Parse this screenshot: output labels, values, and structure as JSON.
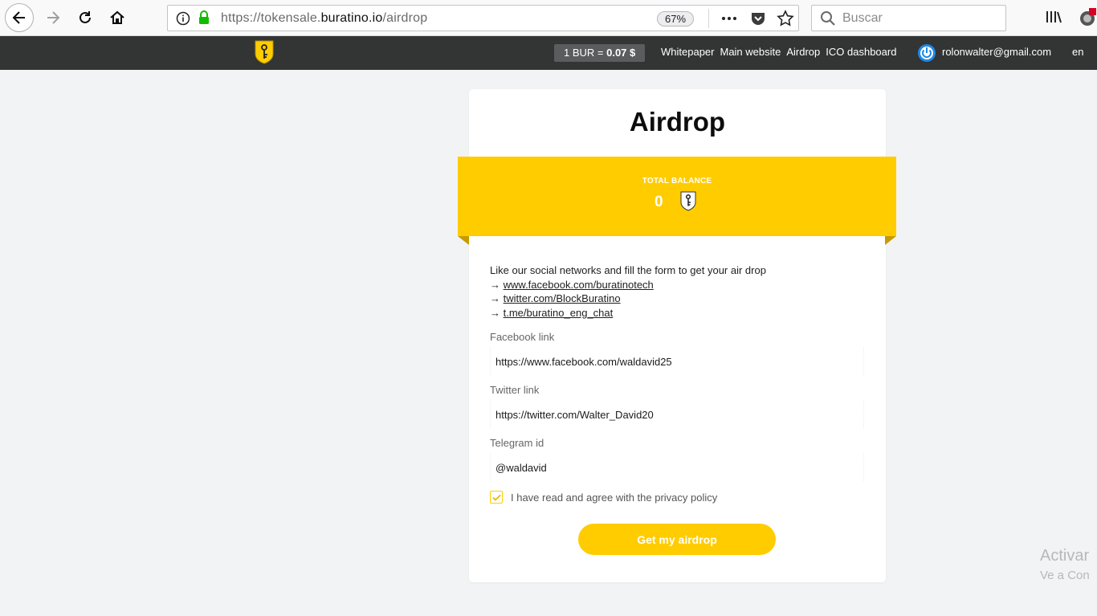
{
  "browser": {
    "url_prefix": "https://tokensale.",
    "url_domain": "buratino.io",
    "url_path": "/airdrop",
    "zoom": "67%",
    "search_placeholder": "Buscar"
  },
  "header": {
    "rate_prefix": "1 BUR = ",
    "rate_value": "0.07 $",
    "nav": [
      "Whitepaper",
      "Main website",
      "Airdrop",
      "ICO dashboard"
    ],
    "user_email": "rolonwalter@gmail.com",
    "language": "en"
  },
  "card": {
    "title": "Airdrop",
    "balance_label": "TOTAL BALANCE",
    "balance_value": "0",
    "intro": "Like our social networks and fill the form to get your air drop",
    "arrow": "→",
    "social_links": [
      "www.facebook.com/buratinotech",
      "twitter.com/BlockBuratino",
      "t.me/buratino_eng_chat"
    ],
    "fields": {
      "facebook": {
        "label": "Facebook link",
        "value": "https://www.facebook.com/waldavid25"
      },
      "twitter": {
        "label": "Twitter link",
        "value": "https://twitter.com/Walter_David20"
      },
      "telegram": {
        "label": "Telegram id",
        "value": "@waldavid"
      }
    },
    "consent_label": "I have read and agree with the privacy policy",
    "consent_checked": true,
    "submit_label": "Get my airdrop"
  },
  "watermark": {
    "line1": "Activar",
    "line2": "Ve a Con"
  },
  "colors": {
    "accent": "#ffcc00",
    "header_bg": "#333434",
    "page_bg": "#f2f3f4"
  },
  "icons": [
    "back-arrow-icon",
    "forward-arrow-icon",
    "reload-icon",
    "home-icon",
    "info-icon",
    "lock-icon",
    "more-icon",
    "pocket-icon",
    "star-icon",
    "search-icon",
    "library-icon",
    "shield-logo-icon",
    "power-icon",
    "token-icon",
    "check-icon"
  ]
}
